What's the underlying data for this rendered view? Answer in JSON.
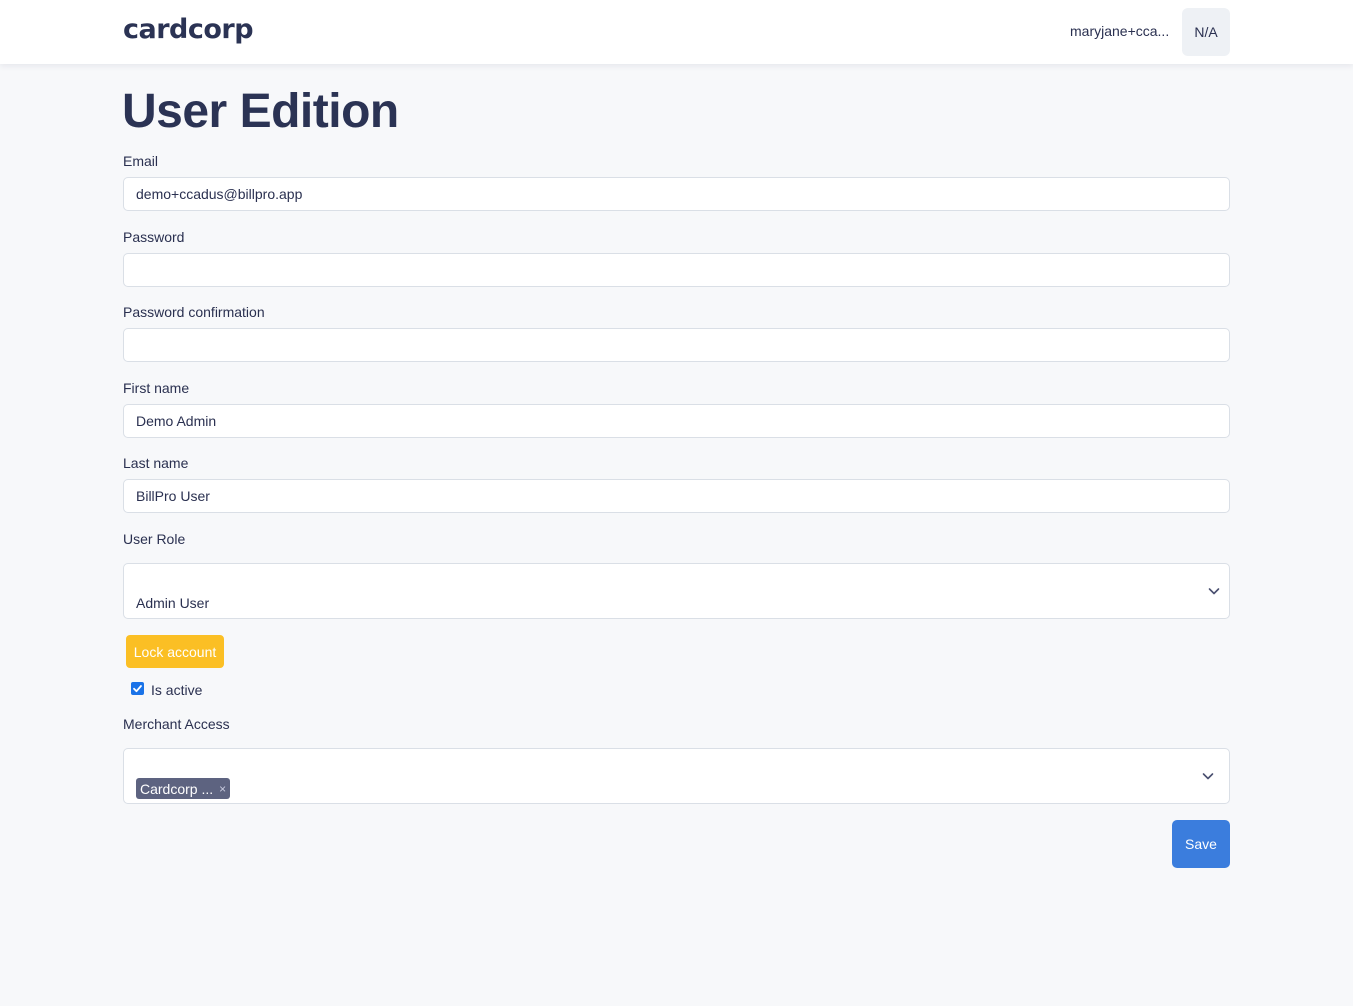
{
  "header": {
    "logo_text": "cardcorp",
    "user_email": "maryjane+cca...",
    "user_badge": "N/A"
  },
  "page": {
    "title": "User Edition"
  },
  "form": {
    "email": {
      "label": "Email",
      "value": "demo+ccadus@billpro.app"
    },
    "password": {
      "label": "Password",
      "value": ""
    },
    "password_confirmation": {
      "label": "Password confirmation",
      "value": ""
    },
    "first_name": {
      "label": "First name",
      "value": "Demo Admin"
    },
    "last_name": {
      "label": "Last name",
      "value": "BillPro User"
    },
    "user_role": {
      "label": "User Role",
      "selected": "Admin User"
    },
    "lock_button": "Lock account",
    "is_active": {
      "label": "Is active",
      "checked": true
    },
    "merchant_access": {
      "label": "Merchant Access",
      "tags": [
        "Cardcorp ..."
      ],
      "tag_remove_glyph": "×"
    },
    "save_button": "Save"
  },
  "colors": {
    "primary": "#3b7ddd",
    "warning": "#fbbf24",
    "tag_bg": "#5d6380",
    "title": "#2b3354",
    "page_bg": "#f7f8fa"
  },
  "icons": {
    "select_chevron": "chevron-down-icon",
    "checkbox_check": "checkmark-icon",
    "tag_remove": "close-icon"
  }
}
